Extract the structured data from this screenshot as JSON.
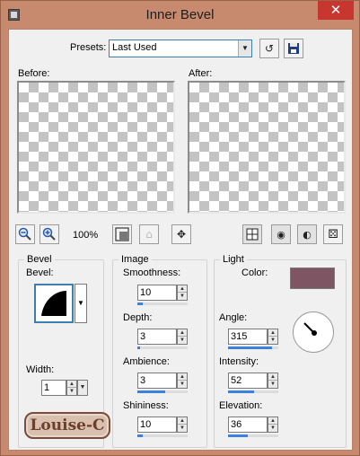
{
  "window": {
    "title": "Inner Bevel",
    "close_label": "✕"
  },
  "presets": {
    "label": "Presets:",
    "value": "Last Used"
  },
  "previews": {
    "before_label": "Before:",
    "after_label": "After:"
  },
  "zoom": {
    "level": "100%"
  },
  "bevel": {
    "group_title": "Bevel",
    "bevel_label": "Bevel:",
    "width_label": "Width:",
    "width_value": "1"
  },
  "image": {
    "group_title": "Image",
    "smoothness": {
      "label": "Smoothness:",
      "value": "10",
      "fill": 0.1
    },
    "depth": {
      "label": "Depth:",
      "value": "3",
      "fill": 0.05
    },
    "ambience": {
      "label": "Ambience:",
      "value": "3",
      "fill": 0.55
    },
    "shininess": {
      "label": "Shininess:",
      "value": "10",
      "fill": 0.1
    }
  },
  "light": {
    "group_title": "Light",
    "color_label": "Color:",
    "color": "#7e5562",
    "angle": {
      "label": "Angle:",
      "value": "315",
      "fill": 0.875
    },
    "intensity": {
      "label": "Intensity:",
      "value": "52",
      "fill": 0.52
    },
    "elevation": {
      "label": "Elevation:",
      "value": "36",
      "fill": 0.4
    }
  },
  "watermark": {
    "text": "Louise-C"
  },
  "colors": {
    "titlebar": "#c78a6e",
    "close": "#c7372f",
    "accent": "#3b82e0"
  }
}
